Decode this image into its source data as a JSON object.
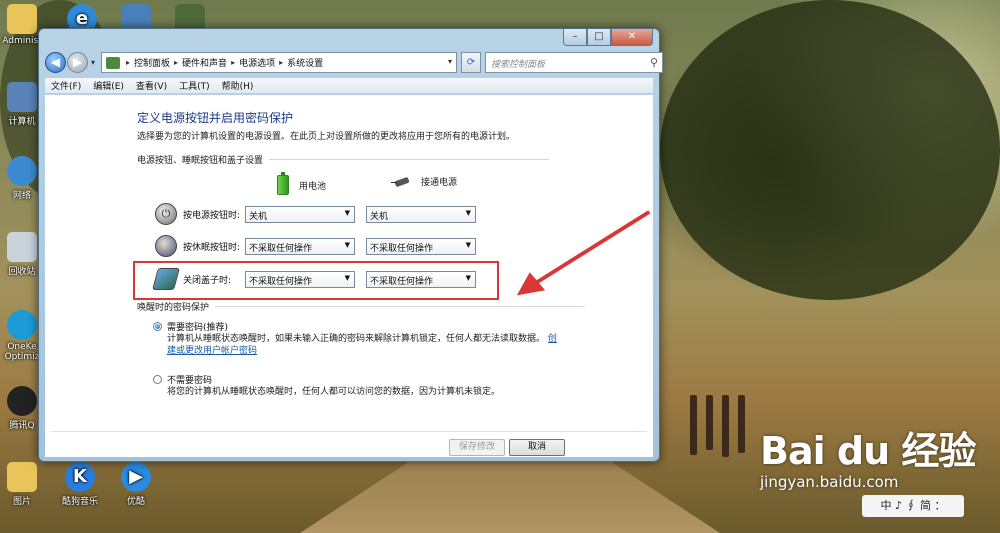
{
  "desktop": {
    "icons": [
      {
        "label": "Administ",
        "name": "admin-folder-icon"
      },
      {
        "label": "计算机",
        "name": "computer-icon"
      },
      {
        "label": "网络",
        "name": "network-icon"
      },
      {
        "label": "回收站",
        "name": "recycle-bin-icon"
      },
      {
        "label": "OneKe Optimiz",
        "name": "onekey-icon"
      },
      {
        "label": "腾讯Q",
        "name": "qq-icon"
      },
      {
        "label": "图片",
        "name": "pictures-folder-icon"
      },
      {
        "label": "酷狗音乐",
        "name": "kugou-icon"
      },
      {
        "label": "优酷",
        "name": "youku-icon"
      }
    ]
  },
  "window": {
    "caption": {
      "minimize": "–",
      "maximize": "□",
      "close": "✕"
    },
    "breadcrumb": [
      "控制面板",
      "硬件和声音",
      "电源选项",
      "系统设置"
    ],
    "search_placeholder": "搜索控制面板",
    "menu": [
      "文件(F)",
      "编辑(E)",
      "查看(V)",
      "工具(T)",
      "帮助(H)"
    ],
    "heading": "定义电源按钮并启用密码保护",
    "description": "选择要为您的计算机设置的电源设置。在此页上对设置所做的更改将应用于您所有的电源计划。",
    "section1_title": "电源按钮、睡眠按钮和盖子设置",
    "col_battery": "用电池",
    "col_plugged": "接通电源",
    "rows": [
      {
        "label": "按电源按钮时:",
        "battery": "关机",
        "plugged": "关机"
      },
      {
        "label": "按休眠按钮时:",
        "battery": "不采取任何操作",
        "plugged": "不采取任何操作"
      },
      {
        "label": "关闭盖子时:",
        "battery": "不采取任何操作",
        "plugged": "不采取任何操作"
      }
    ],
    "section2_title": "唤醒时的密码保护",
    "option_require": {
      "label": "需要密码(推荐)",
      "desc": "计算机从睡眠状态唤醒时，如果未输入正确的密码来解除计算机锁定，任何人都无法读取数据。",
      "link_a": "创",
      "link_b": "建或更改用户帐户密码"
    },
    "option_none": {
      "label": "不需要密码",
      "desc": "将您的计算机从睡眠状态唤醒时，任何人都可以访问您的数据，因为计算机未锁定。"
    },
    "save_button": "保存修改",
    "cancel_button": "取消"
  },
  "watermark": {
    "brand": "Bai du 经验",
    "url": "jingyan.baidu.com",
    "badge": "中 ♪ ∮ 简 ："
  },
  "colors": {
    "highlight": "#d93636",
    "heading": "#1e3a8a",
    "link": "#1a5aa8"
  }
}
